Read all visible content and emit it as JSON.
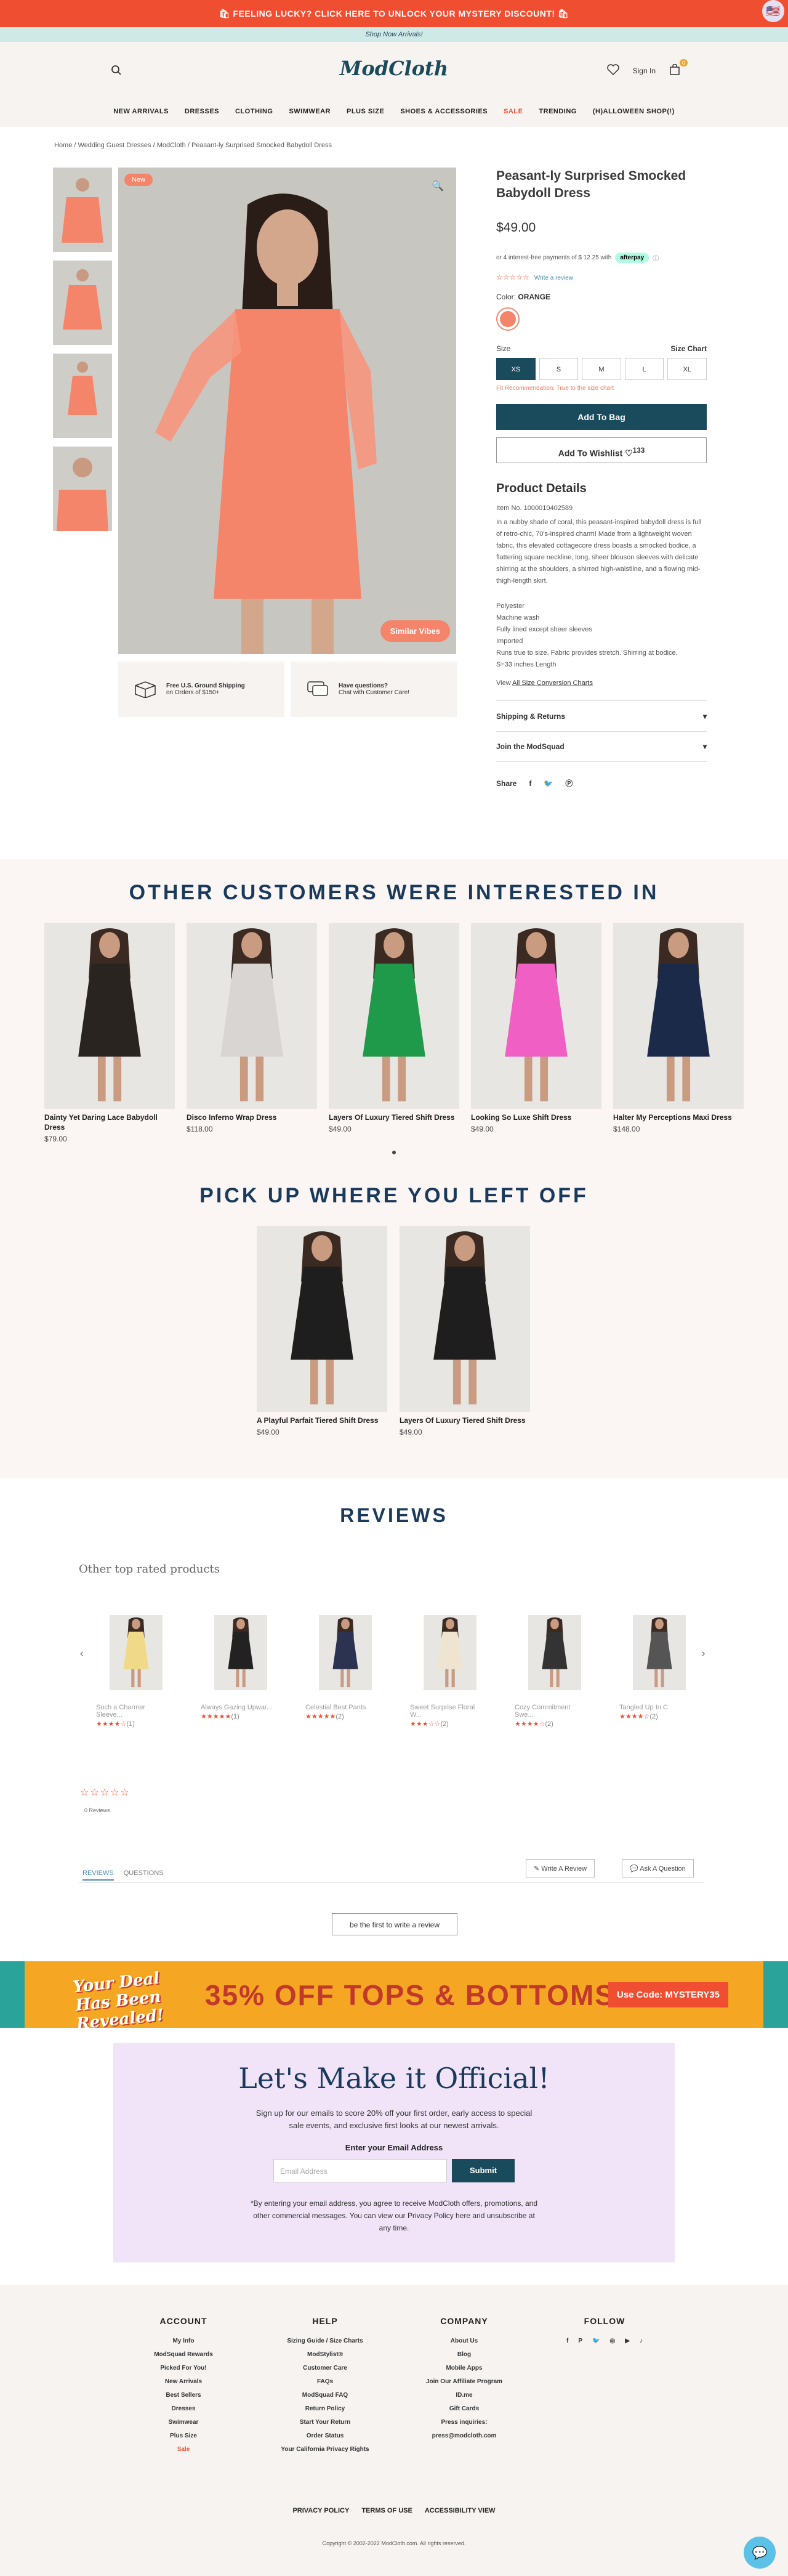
{
  "promo": {
    "text": "🛍 FEELING LUCKY? CLICK HERE TO UNLOCK YOUR MYSTERY DISCOUNT! 🛍",
    "flag": "🇺🇸"
  },
  "shipping_bar": {
    "text": "Shop Now Arrivals!"
  },
  "header": {
    "logo": "ModCloth",
    "signin": "Sign In",
    "cart_count": "0",
    "nav": [
      "NEW ARRIVALS",
      "DRESSES",
      "CLOTHING",
      "SWIMWEAR",
      "PLUS SIZE",
      "SHOES & ACCESSORIES",
      "SALE",
      "TRENDING",
      "(H)ALLOWEEN SHOP(!)"
    ]
  },
  "breadcrumb": "Home / Wedding Guest Dresses / ModCloth / Peasant-ly Surprised Smocked Babydoll Dress",
  "product": {
    "new_tag": "New",
    "similar": "Similar Vibes",
    "title": "Peasant-ly Surprised Smocked Babydoll Dress",
    "price": "$49.00",
    "afterpay": "or 4 interest-free payments of $ 12.25 with",
    "afterpay_logo": "afterpay",
    "write_review": "Write a review",
    "color_label": "Color:",
    "color_value": "ORANGE",
    "size_label": "Size",
    "size_chart": "Size Chart",
    "sizes": [
      "XS",
      "S",
      "M",
      "L",
      "XL"
    ],
    "fit_rec": "Fit Recommendation: True to the size chart",
    "add_bag": "Add To Bag",
    "wishlist": "Add To Wishlist",
    "wishlist_count": "133",
    "details_heading": "Product Details",
    "item_no": "Item No. 1000010402589",
    "description": "In a nubby shade of coral, this peasant-inspired babydoll dress is full of retro-chic, 70's-inspired charm! Made from a lightweight woven fabric, this elevated cottagecore dress boasts a smocked bodice, a flattering square neckline, long, sheer blouson sleeves with delicate shirring at the shoulders, a shirred high-waistline, and a flowing mid-thigh-length skirt.",
    "features": [
      "Polyester",
      "Machine wash",
      "Fully lined except sheer sleeves",
      "Imported",
      "Runs true to size. Fabric provides stretch. Shirring at bodice.",
      "S=33 inches Length"
    ],
    "size_conv_prefix": "View",
    "size_conv_link": "All Size Conversion Charts",
    "shipping_returns": "Shipping & Returns",
    "join": "Join the ModSquad",
    "share": "Share"
  },
  "perks": [
    {
      "title": "Free U.S. Ground Shipping",
      "sub": "on Orders of $150+"
    },
    {
      "title": "Have questions?",
      "sub": "Chat with Customer Care!"
    }
  ],
  "interested": {
    "heading": "OTHER CUSTOMERS WERE INTERESTED IN",
    "items": [
      {
        "name": "Dainty Yet Daring Lace Babydoll Dress",
        "price": "$79.00",
        "color": "#2a2420"
      },
      {
        "name": "Disco Inferno Wrap Dress",
        "price": "$118.00",
        "color": "#d8d5d2"
      },
      {
        "name": "Layers Of Luxury Tiered Shift Dress",
        "price": "$49.00",
        "color": "#1f9a4b"
      },
      {
        "name": "Looking So Luxe Shift Dress",
        "price": "$49.00",
        "color": "#f05fc3"
      },
      {
        "name": "Halter My Perceptions Maxi Dress",
        "price": "$148.00",
        "color": "#1c2a4a"
      }
    ]
  },
  "recent": {
    "heading": "PICK UP WHERE YOU LEFT OFF",
    "items": [
      {
        "name": "A Playful Parfait Tiered Shift Dress",
        "price": "$49.00",
        "color": "#1e1e1e"
      },
      {
        "name": "Layers Of Luxury Tiered Shift Dress",
        "price": "$49.00",
        "color": "#1e1e1e"
      }
    ]
  },
  "reviews": {
    "heading": "REVIEWS",
    "other_top": "Other top rated products",
    "top_products": [
      {
        "name": "Such a Charmer Sleeve...",
        "stars": "★★★★☆",
        "count": "(1)",
        "color": "#f1d98a"
      },
      {
        "name": "Always Gazing Upwar...",
        "stars": "★★★★★",
        "count": "(1)",
        "color": "#222"
      },
      {
        "name": "Celestial Best Pants",
        "stars": "★★★★★",
        "count": "(2)",
        "color": "#2b3350"
      },
      {
        "name": "Sweet Surprise Floral W...",
        "stars": "★★★☆☆",
        "count": "(2)",
        "color": "#efe4d0"
      },
      {
        "name": "Cozy Commitment Swe...",
        "stars": "★★★★☆",
        "count": "(2)",
        "color": "#333"
      },
      {
        "name": "Tangled Up In C",
        "stars": "★★★★☆",
        "count": "(2)",
        "color": "#555"
      }
    ],
    "empty_stars": "☆☆☆☆☆",
    "no_reviews": "0 Reviews",
    "tab_reviews": "REVIEWS",
    "tab_questions": "QUESTIONS",
    "write_review": "Write A Review",
    "ask_question": "Ask A Question",
    "first": "be the first to write a review"
  },
  "banner": {
    "deal": "Your Deal Has Been Revealed!",
    "offer": "35% OFF TOPS & BOTTOMS",
    "code": "Use Code: MYSTERY35"
  },
  "newsletter": {
    "heading": "Let's Make it Official!",
    "text": "Sign up for our emails to score 20% off your first order, early access to special sale events, and exclusive first looks at our newest arrivals.",
    "label": "Enter your Email Address",
    "placeholder": "Email Address",
    "submit": "Submit",
    "disclaimer": "*By entering your email address, you agree to receive ModCloth offers, promotions, and other commercial messages. You can view our Privacy Policy here and unsubscribe at any time."
  },
  "footer": {
    "account": {
      "title": "ACCOUNT",
      "links": [
        "My Info",
        "ModSquad Rewards",
        "Picked For You!",
        "New Arrivals",
        "Best Sellers",
        "Dresses",
        "Swimwear",
        "Plus Size",
        "Sale"
      ]
    },
    "help": {
      "title": "HELP",
      "links": [
        "Sizing Guide / Size Charts",
        "ModStylist®",
        "Customer Care",
        "FAQs",
        "ModSquad FAQ",
        "Return Policy",
        "Start Your Return",
        "Order Status",
        "Your California Privacy Rights"
      ]
    },
    "company": {
      "title": "COMPANY",
      "links": [
        "About Us",
        "Blog",
        "Mobile Apps",
        "Join Our Affiliate Program",
        "ID.me",
        "Gift Cards",
        "Press inquiries: press@modcloth.com"
      ]
    },
    "follow": {
      "title": "FOLLOW",
      "icons": [
        "f",
        "P",
        "🐦",
        "◎",
        "▶",
        "♪"
      ]
    },
    "bottom_links": [
      "PRIVACY POLICY",
      "TERMS OF USE",
      "ACCESSIBILITY VIEW"
    ],
    "copyright": "Copyright © 2002-2022 ModCloth.com. All rights reserved."
  },
  "colors": {
    "brand": "#1a4b5c",
    "accent": "#f04e30",
    "product": "#f4846a"
  }
}
